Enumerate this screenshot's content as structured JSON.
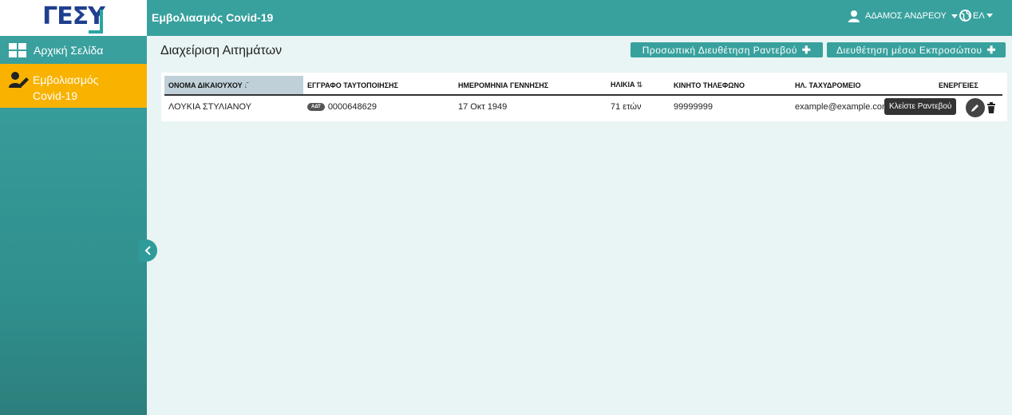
{
  "logo": {
    "text": "ΓΕΣΥ"
  },
  "header": {
    "app_title": "Εμβολιασμός Covid-19",
    "user_name": "ΑΔΑΜΟΣ ΑΝΔΡΕΟΥ",
    "language": "ΕΛ"
  },
  "sidebar": {
    "items": [
      {
        "label": "Αρχική Σελίδα",
        "icon": "dashboard-icon"
      },
      {
        "label": "Εμβολιασμός Covid-19",
        "icon": "user-edit-icon",
        "active": true
      }
    ]
  },
  "main": {
    "title": "Διαχείριση Αιτημάτων",
    "buttons": {
      "personal": "Προσωπική Διευθέτηση Ραντεβού",
      "representative": "Διευθέτηση μέσω Εκπροσώπου"
    },
    "table": {
      "columns": [
        "ΟΝΟΜΑ ΔΙΚΑΙΟΥΧΟΥ",
        "ΕΓΓΡΑΦΟ ΤΑΥΤΟΠΟΙΗΣΗΣ",
        "ΗΜΕΡΟΜΗΝΙΑ ΓΕΝΝΗΣΗΣ",
        "ΗΛΙΚΙΑ",
        "ΚΙΝΗΤΟ ΤΗΛΕΦΩΝΟ",
        "ΗΛ. ΤΑΧΥΔΡΟΜΕΙΟ",
        "ΕΝΕΡΓΕΙΕΣ"
      ],
      "rows": [
        {
          "name": "ΛΟΥΚΙΑ ΣΤΥΛΙΑΝΟΥ",
          "doc_type": "ΑΔΤ",
          "doc_number": "0000648629",
          "birth_date": "17 Οκτ 1949",
          "age": "71 ετών",
          "phone": "99999999",
          "email": "example@example.com"
        }
      ]
    },
    "tooltip": "Κλείστε Ραντεβού"
  },
  "colors": {
    "accent": "#38a19e",
    "active": "#f9b200",
    "brand": "#1f3f8f"
  }
}
